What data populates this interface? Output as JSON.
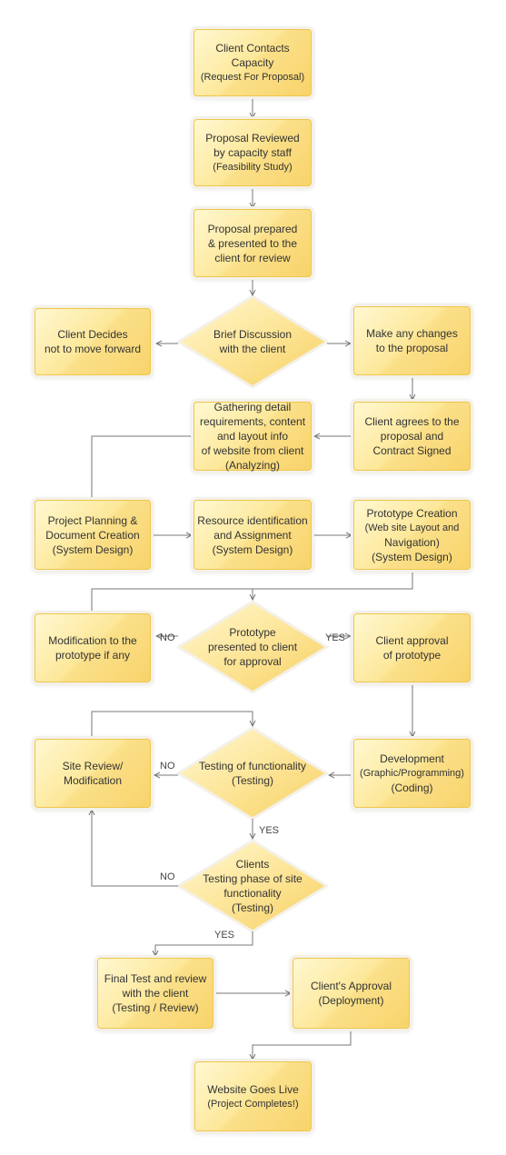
{
  "colors": {
    "box_light": "#fff8d2",
    "box_dark": "#f8d36a",
    "border": "#efc64c",
    "connector": "#777777",
    "text": "#333333"
  },
  "nodes": {
    "client_contacts": {
      "shape": "box",
      "lines": [
        "Client Contacts",
        "Capacity",
        "(Request For Proposal)"
      ]
    },
    "proposal_reviewed": {
      "shape": "box",
      "lines": [
        "Proposal Reviewed",
        "by capacity staff",
        "(Feasibility Study)"
      ]
    },
    "proposal_prepared": {
      "shape": "box",
      "lines": [
        "Proposal prepared",
        "& presented to the",
        "client for review"
      ]
    },
    "brief_discussion": {
      "shape": "diamond",
      "lines": [
        "Brief Discussion",
        "with the client"
      ]
    },
    "client_decides": {
      "shape": "box",
      "lines": [
        "Client Decides",
        "not to move forward"
      ]
    },
    "make_changes": {
      "shape": "box",
      "lines": [
        "Make any changes",
        "to the proposal"
      ]
    },
    "client_agrees": {
      "shape": "box",
      "lines": [
        "Client agrees to the",
        "proposal and",
        "Contract Signed"
      ]
    },
    "gathering": {
      "shape": "box",
      "lines": [
        "Gathering detail",
        "requirements, content",
        "and layout info",
        "of website from client",
        "(Analyzing)"
      ]
    },
    "project_planning": {
      "shape": "box",
      "lines": [
        "Project Planning &",
        "Document Creation",
        "(System Design)"
      ]
    },
    "resource_identification": {
      "shape": "box",
      "lines": [
        "Resource identification",
        "and Assignment",
        "(System Design)"
      ]
    },
    "prototype_creation": {
      "shape": "box",
      "lines": [
        "Prototype Creation",
        "(Web site Layout and",
        "Navigation)",
        "(System Design)"
      ]
    },
    "prototype_presented": {
      "shape": "diamond",
      "lines": [
        "Prototype",
        "presented to client",
        "for approval"
      ]
    },
    "modification_prototype": {
      "shape": "box",
      "lines": [
        "Modification to the",
        "prototype if any"
      ]
    },
    "client_approval_prototype": {
      "shape": "box",
      "lines": [
        "Client approval",
        "of prototype"
      ]
    },
    "testing_functionality": {
      "shape": "diamond",
      "lines": [
        "Testing of functionality",
        "(Testing)"
      ]
    },
    "site_review": {
      "shape": "box",
      "lines": [
        "Site Review/",
        "Modification"
      ]
    },
    "development": {
      "shape": "box",
      "lines": [
        "Development",
        "(Graphic/Programming)",
        "(Coding)"
      ]
    },
    "clients_testing": {
      "shape": "diamond",
      "lines": [
        "Clients",
        "Testing phase of site",
        "functionality",
        "(Testing)"
      ]
    },
    "final_test": {
      "shape": "box",
      "lines": [
        "Final Test and review",
        "with the client",
        "(Testing / Review)"
      ]
    },
    "clients_approval": {
      "shape": "box",
      "lines": [
        "Client's Approval",
        "(Deployment)"
      ]
    },
    "website_live": {
      "shape": "box",
      "lines": [
        "Website Goes Live",
        "(Project Completes!)"
      ]
    }
  },
  "edge_labels": {
    "no_1": "NO",
    "yes_1": "YES",
    "no_2": "NO",
    "yes_2": "YES",
    "no_3": "NO",
    "yes_3": "YES"
  }
}
